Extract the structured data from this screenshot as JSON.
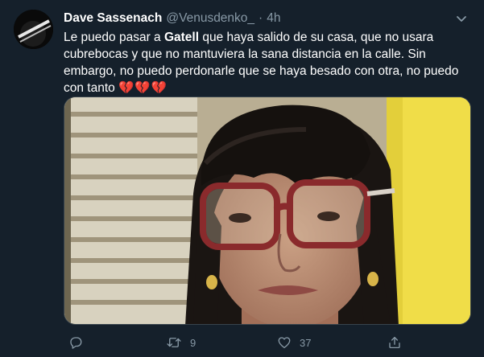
{
  "tweet": {
    "author": {
      "display_name": "Dave Sassenach",
      "handle": "@Venusdenko_"
    },
    "separator": "·",
    "time": "4h",
    "text": {
      "part1": "Le puedo pasar a ",
      "bold": "Gatell",
      "part2": " que haya salido de su casa, que no usara cubrebocas y que no mantuviera la sana distancia en la calle. Sin embargo, no puedo perdonarle que se haya besado con otra, no puedo con tanto ",
      "emoji": "💔💔💔"
    },
    "actions": {
      "reply_count": "",
      "retweet_count": "9",
      "like_count": "37"
    }
  },
  "colors": {
    "background": "#15202b",
    "text_primary": "#ffffff",
    "text_secondary": "#8899a6",
    "border": "#38444d"
  },
  "icons": {
    "caret": "chevron-down-icon",
    "reply": "reply-icon",
    "retweet": "retweet-icon",
    "like": "heart-icon",
    "share": "share-icon"
  }
}
